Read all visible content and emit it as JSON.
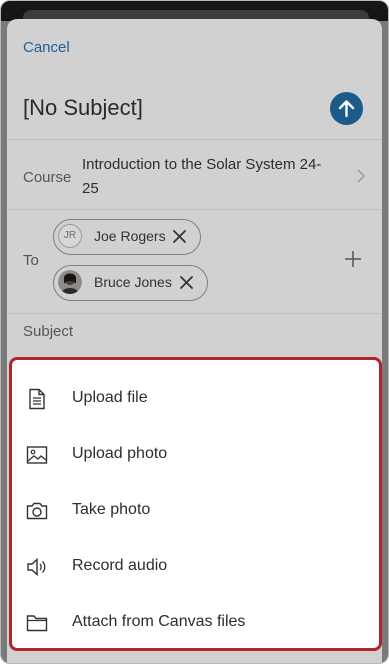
{
  "header": {
    "cancel_label": "Cancel",
    "title": "[No Subject]",
    "send_icon": "arrow-up-icon",
    "accent_color": "#1c5a8a"
  },
  "course": {
    "label": "Course",
    "value": "Introduction to the Solar System 24-25"
  },
  "to": {
    "label": "To",
    "recipients": [
      {
        "initials": "JR",
        "name": "Joe Rogers",
        "remove_icon": "close-icon"
      },
      {
        "initials": "",
        "name": "Bruce Jones",
        "remove_icon": "close-icon"
      }
    ],
    "add_icon": "plus-icon"
  },
  "subject": {
    "placeholder": "Subject"
  },
  "attach_menu": {
    "highlight_color": "#b0242c",
    "items": [
      {
        "label": "Upload file",
        "icon": "document-icon"
      },
      {
        "label": "Upload photo",
        "icon": "image-icon"
      },
      {
        "label": "Take photo",
        "icon": "camera-icon"
      },
      {
        "label": "Record audio",
        "icon": "speaker-icon"
      },
      {
        "label": "Attach from Canvas files",
        "icon": "folder-icon"
      }
    ]
  }
}
